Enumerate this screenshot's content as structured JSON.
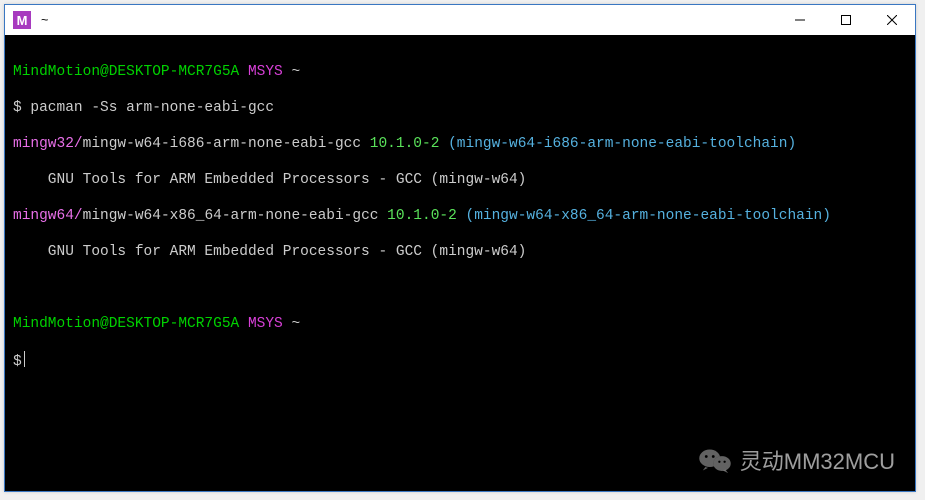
{
  "window": {
    "icon_letter": "M",
    "title": "~"
  },
  "prompt1": {
    "user": "MindMotion",
    "at": "@",
    "host": "DESKTOP-MCR7G5A",
    "env": "MSYS",
    "path": "~",
    "ps": "$",
    "cmd": "pacman -Ss arm-none-eabi-gcc"
  },
  "result1": {
    "repo": "mingw32/",
    "pkg": "mingw-w64-i686-arm-none-eabi-gcc",
    "ver": " 10.1.0-2 ",
    "group": "(mingw-w64-i686-arm-none-eabi-toolchain)",
    "desc": "    GNU Tools for ARM Embedded Processors - GCC (mingw-w64)"
  },
  "result2": {
    "repo": "mingw64/",
    "pkg": "mingw-w64-x86_64-arm-none-eabi-gcc",
    "ver": " 10.1.0-2 ",
    "group": "(mingw-w64-x86_64-arm-none-eabi-toolchain)",
    "desc": "    GNU Tools for ARM Embedded Processors - GCC (mingw-w64)"
  },
  "prompt2": {
    "user": "MindMotion",
    "at": "@",
    "host": "DESKTOP-MCR7G5A",
    "env": "MSYS",
    "path": "~",
    "ps": "$"
  },
  "watermark": {
    "text": "灵动MM32MCU"
  }
}
